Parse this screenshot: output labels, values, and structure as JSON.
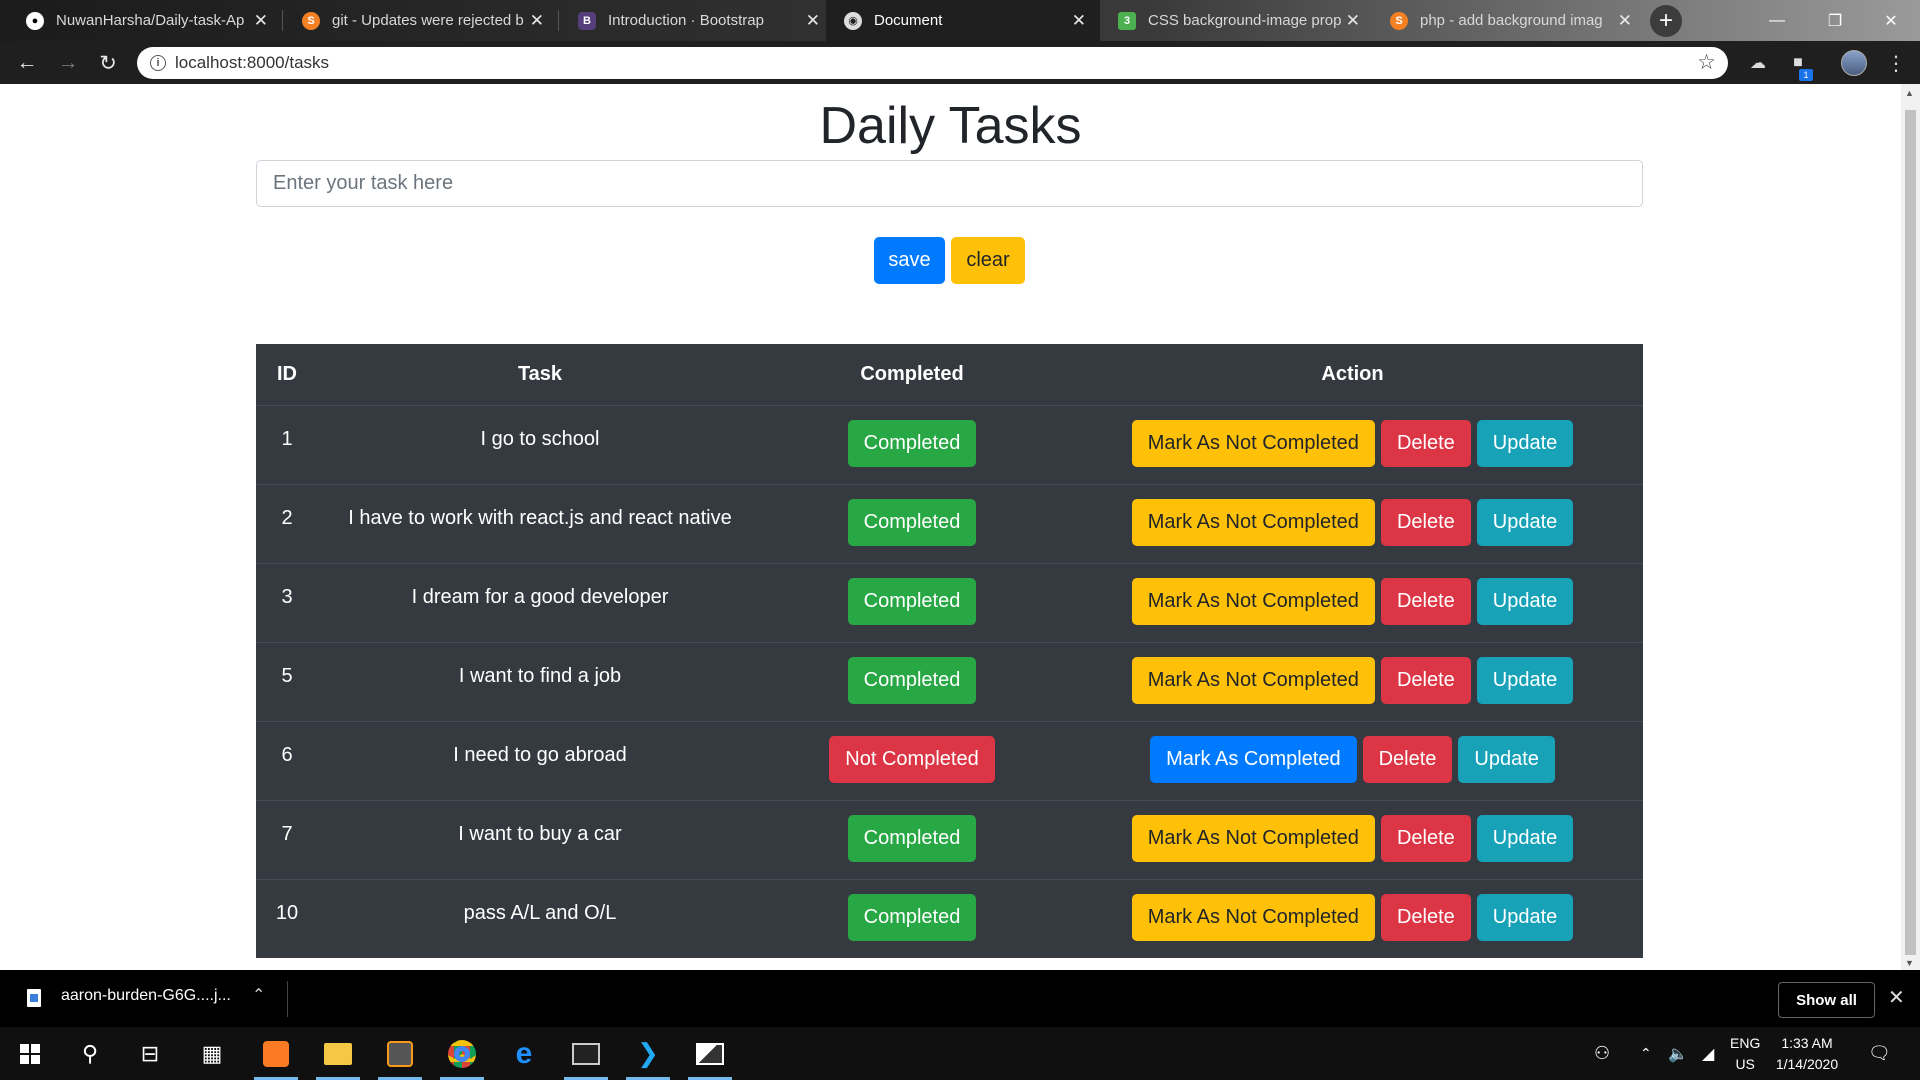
{
  "browser": {
    "tabs": [
      {
        "title": "NuwanHarsha/Daily-task-Ap",
        "icon": "github-icon",
        "active": false
      },
      {
        "title": "git - Updates were rejected b",
        "icon": "stackoverflow-icon",
        "active": false
      },
      {
        "title": "Introduction · Bootstrap",
        "icon": "bootstrap-icon",
        "active": false
      },
      {
        "title": "Document",
        "icon": "globe-icon",
        "active": true
      },
      {
        "title": "CSS background-image prop",
        "icon": "w3schools-icon",
        "active": false
      },
      {
        "title": "php - add background imag",
        "icon": "stackoverflow-icon",
        "active": false
      }
    ],
    "url": "localhost:8000/tasks"
  },
  "page": {
    "title": "Daily Tasks",
    "input_placeholder": "Enter your task here",
    "save_label": "save",
    "clear_label": "clear"
  },
  "table": {
    "headers": {
      "id": "ID",
      "task": "Task",
      "completed": "Completed",
      "action": "Action"
    },
    "rows": [
      {
        "id": "1",
        "task": "I go to school",
        "status": "Completed",
        "toggle": "Mark As Not Completed",
        "delete": "Delete",
        "update": "Update"
      },
      {
        "id": "2",
        "task": "I have to work with react.js and react native",
        "status": "Completed",
        "toggle": "Mark As Not Completed",
        "delete": "Delete",
        "update": "Update"
      },
      {
        "id": "3",
        "task": "I dream for a good developer",
        "status": "Completed",
        "toggle": "Mark As Not Completed",
        "delete": "Delete",
        "update": "Update"
      },
      {
        "id": "5",
        "task": "I want to find a job",
        "status": "Completed",
        "toggle": "Mark As Not Completed",
        "delete": "Delete",
        "update": "Update"
      },
      {
        "id": "6",
        "task": "I need to go abroad",
        "status": "Not Completed",
        "toggle": "Mark As Completed",
        "delete": "Delete",
        "update": "Update"
      },
      {
        "id": "7",
        "task": "I want to buy a car",
        "status": "Completed",
        "toggle": "Mark As Not Completed",
        "delete": "Delete",
        "update": "Update"
      },
      {
        "id": "10",
        "task": "pass A/L and O/L",
        "status": "Completed",
        "toggle": "Mark As Not Completed",
        "delete": "Delete",
        "update": "Update"
      }
    ]
  },
  "downloads": {
    "file_name": "aaron-burden-G6G....j...",
    "show_all": "Show all"
  },
  "taskbar": {
    "lang_line1": "ENG",
    "lang_line2": "US",
    "time": "1:33 AM",
    "date": "1/14/2020"
  },
  "colors": {
    "primary": "#007bff",
    "warning": "#ffc107",
    "danger": "#dc3545",
    "success": "#28a745",
    "info": "#17a2b8",
    "table_dark": "#343a40"
  }
}
